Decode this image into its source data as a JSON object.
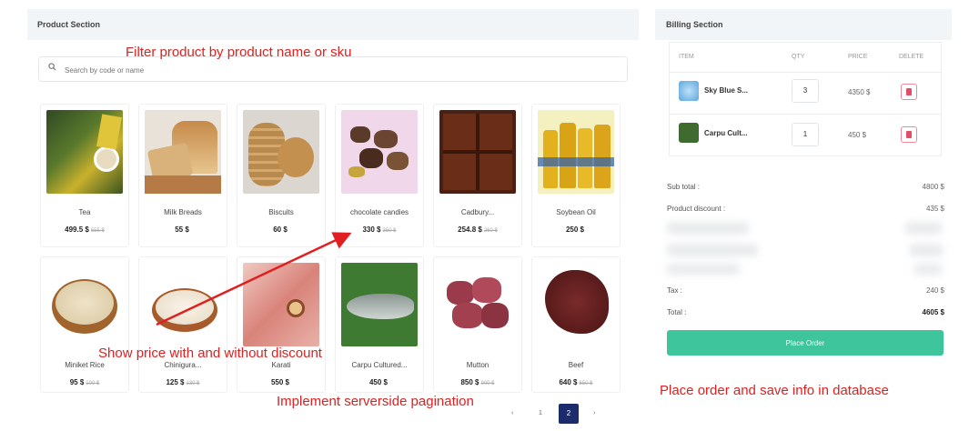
{
  "product_section": {
    "title": "Product Section",
    "search_placeholder": "Search by code or name",
    "products": [
      {
        "name": "Tea",
        "price": "499.5 $",
        "old_price": "555 $"
      },
      {
        "name": "Milk Breads",
        "price": "55 $",
        "old_price": ""
      },
      {
        "name": "Biscuits",
        "price": "60 $",
        "old_price": ""
      },
      {
        "name": "chocolate candies",
        "price": "330 $",
        "old_price": "350 $"
      },
      {
        "name": "Cadbury...",
        "price": "254.8 $",
        "old_price": "260 $"
      },
      {
        "name": "Soybean Oil",
        "price": "250 $",
        "old_price": ""
      },
      {
        "name": "Miniket Rice",
        "price": "95 $",
        "old_price": "100 $"
      },
      {
        "name": "Chinigura...",
        "price": "125 $",
        "old_price": "130 $"
      },
      {
        "name": "Karati",
        "price": "550 $",
        "old_price": ""
      },
      {
        "name": "Carpu Cultured...",
        "price": "450 $",
        "old_price": ""
      },
      {
        "name": "Mutton",
        "price": "850 $",
        "old_price": "900 $"
      },
      {
        "name": "Beef",
        "price": "640 $",
        "old_price": "650 $"
      }
    ],
    "pagination": {
      "prev": "‹",
      "page": "1",
      "active": "2",
      "next": "›"
    }
  },
  "billing_section": {
    "title": "Billing Section",
    "headers": {
      "item": "ITEM",
      "qty": "QTY",
      "price": "PRICE",
      "delete": "DELETE"
    },
    "items": [
      {
        "name": "Sky Blue S...",
        "qty": "3",
        "price": "4350 $"
      },
      {
        "name": "Carpu Cult...",
        "qty": "1",
        "price": "450 $"
      }
    ],
    "subtotal_label": "Sub total :",
    "subtotal_value": "4800 $",
    "discount_label": "Product discount :",
    "discount_value": "435 $",
    "tax_label": "Tax :",
    "tax_value": "240 $",
    "total_label": "Total :",
    "total_value": "4605 $",
    "place_order": "Place Order"
  },
  "annotations": {
    "filter": "Filter product by product name or sku",
    "price": "Show price with and without discount",
    "pagination": "Implement serverside pagination",
    "order": "Place order and save info in database"
  },
  "colors": {
    "accent": "#3ec59b",
    "annotation": "#e02020",
    "active_page": "#1c2b6b",
    "delete": "#e34d66"
  }
}
